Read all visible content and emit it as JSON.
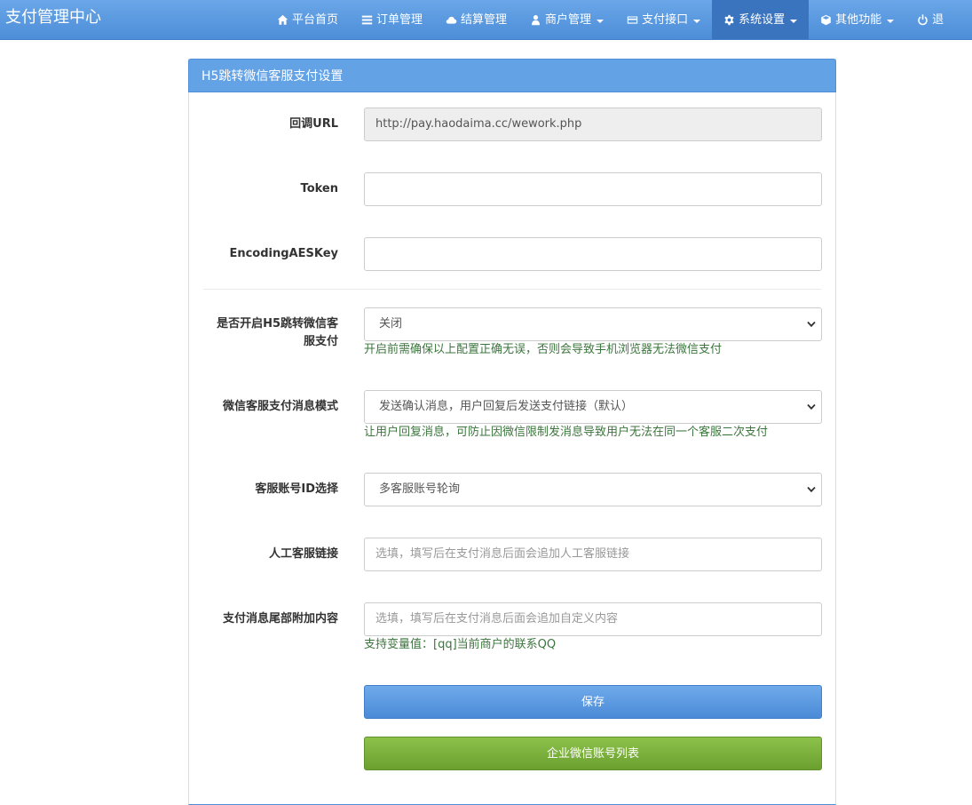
{
  "navbar": {
    "brand": "支付管理中心",
    "items": [
      {
        "label": "平台首页",
        "icon": "home-icon",
        "dropdown": false
      },
      {
        "label": "订单管理",
        "icon": "list-icon",
        "dropdown": false
      },
      {
        "label": "结算管理",
        "icon": "cloud-icon",
        "dropdown": false
      },
      {
        "label": "商户管理",
        "icon": "user-icon",
        "dropdown": true
      },
      {
        "label": "支付接口",
        "icon": "credit-card-icon",
        "dropdown": true
      },
      {
        "label": "系统设置",
        "icon": "gear-icon",
        "dropdown": true,
        "active": true
      },
      {
        "label": "其他功能",
        "icon": "cube-icon",
        "dropdown": true
      },
      {
        "label": "退",
        "icon": "power-icon",
        "dropdown": false
      }
    ]
  },
  "panel": {
    "title": "H5跳转微信客服支付设置"
  },
  "form": {
    "callback_url": {
      "label": "回调URL",
      "value": "http://pay.haodaima.cc/wework.php"
    },
    "token": {
      "label": "Token",
      "value": ""
    },
    "aeskey": {
      "label": "EncodingAESKey",
      "value": ""
    },
    "enable": {
      "label_line1": "是否开启H5跳转微信客",
      "label_line2": "服支付",
      "value": "关闭",
      "help": "开启前需确保以上配置正确无误，否则会导致手机浏览器无法微信支付"
    },
    "msg_mode": {
      "label": "微信客服支付消息模式",
      "value": "发送确认消息，用户回复后发送支付链接（默认）",
      "help": "让用户回复消息，可防止因微信限制发消息导致用户无法在同一个客服二次支付"
    },
    "account_select": {
      "label": "客服账号ID选择",
      "value": "多客服账号轮询"
    },
    "manual_link": {
      "label": "人工客服链接",
      "placeholder": "选填，填写后在支付消息后面会追加人工客服链接"
    },
    "tail_content": {
      "label": "支付消息尾部附加内容",
      "placeholder": "选填，填写后在支付消息后面会追加自定义内容",
      "help": "支持变量值：[qq]当前商户的联系QQ"
    }
  },
  "buttons": {
    "save": "保存",
    "account_list": "企业微信账号列表"
  }
}
